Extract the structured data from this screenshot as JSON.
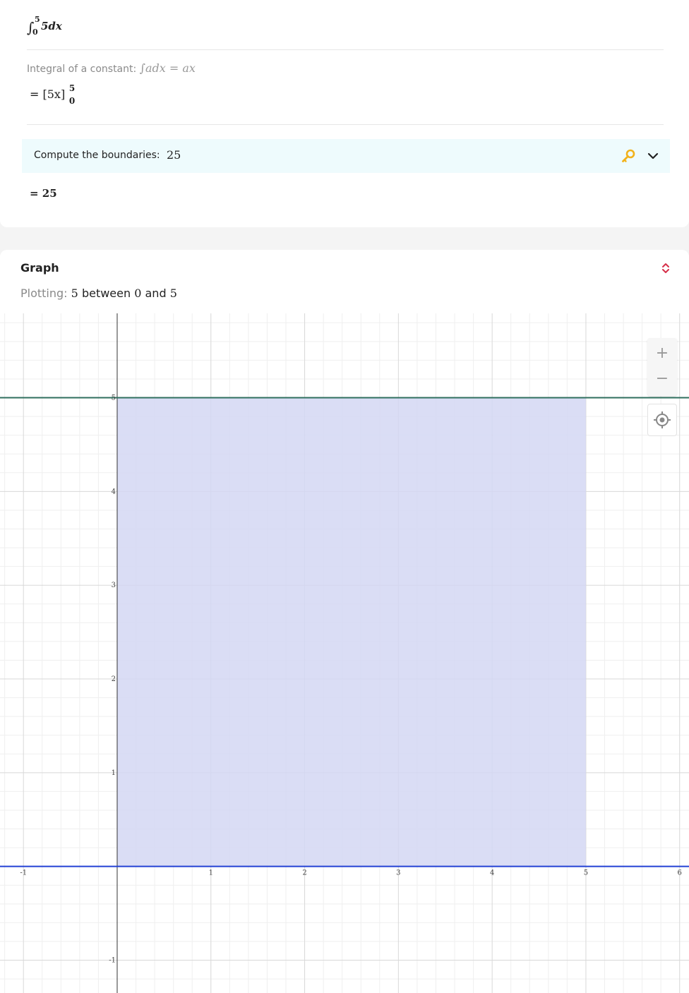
{
  "problem": {
    "integral_upper": "5",
    "integral_lower": "0",
    "integrand": "5dx"
  },
  "steps": [
    {
      "description": "Integral of a constant:",
      "rule": "∫adx = ax",
      "result_prefix": "=",
      "result_expr": "[5x]",
      "upper_bound": "5",
      "lower_bound": "0"
    }
  ],
  "compute": {
    "label": "Compute the boundaries:",
    "value": "25",
    "key_icon": "key-icon",
    "expand_icon": "chevron-down-icon"
  },
  "final_result": "= 25",
  "graph": {
    "title": "Graph",
    "toggle_icon": "expand-collapse-icon",
    "plotting_label": "Plotting:",
    "plotting_func": "5",
    "plotting_between": "between",
    "plotting_from": "0",
    "plotting_and": "and",
    "plotting_to": "5",
    "zoom_in": "+",
    "zoom_out": "−",
    "recenter_icon": "crosshair-icon"
  },
  "chart_data": {
    "type": "area",
    "function": "5",
    "fill_from": 0,
    "fill_to": 5,
    "xlim": [
      -1.25,
      6.1
    ],
    "ylim": [
      -1.35,
      5.9
    ],
    "x_ticks": [
      "-1",
      "1",
      "2",
      "3",
      "4",
      "5",
      "6"
    ],
    "y_ticks": [
      "-1",
      "1",
      "2",
      "3",
      "4",
      "5"
    ],
    "colors": {
      "function_line": "#2f6f5e",
      "x_axis_line": "#2340d4",
      "fill": "#d4d7f3"
    },
    "grid": true
  }
}
